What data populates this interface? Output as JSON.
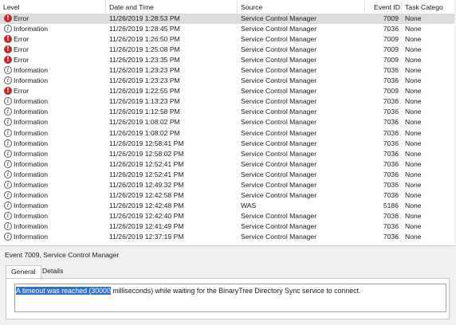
{
  "columns": {
    "level": "Level",
    "date_time": "Date and Time",
    "source": "Source",
    "event_id": "Event ID",
    "task_category": "Task Catego"
  },
  "events": [
    {
      "level": "Error",
      "type": "error",
      "date": "11/26/2019 1:28:53 PM",
      "source": "Service Control Manager",
      "event_id": "7009",
      "task": "None",
      "selected": true
    },
    {
      "level": "Information",
      "type": "info",
      "date": "11/26/2019 1:28:45 PM",
      "source": "Service Control Manager",
      "event_id": "7036",
      "task": "None"
    },
    {
      "level": "Error",
      "type": "error",
      "date": "11/26/2019 1:26:50 PM",
      "source": "Service Control Manager",
      "event_id": "7009",
      "task": "None"
    },
    {
      "level": "Error",
      "type": "error",
      "date": "11/26/2019 1:25:08 PM",
      "source": "Service Control Manager",
      "event_id": "7009",
      "task": "None"
    },
    {
      "level": "Error",
      "type": "error",
      "date": "11/26/2019 1:23:35 PM",
      "source": "Service Control Manager",
      "event_id": "7009",
      "task": "None"
    },
    {
      "level": "Information",
      "type": "info",
      "date": "11/26/2019 1:23:23 PM",
      "source": "Service Control Manager",
      "event_id": "7036",
      "task": "None"
    },
    {
      "level": "Information",
      "type": "info",
      "date": "11/26/2019 1:23:23 PM",
      "source": "Service Control Manager",
      "event_id": "7036",
      "task": "None"
    },
    {
      "level": "Error",
      "type": "error",
      "date": "11/26/2019 1:22:55 PM",
      "source": "Service Control Manager",
      "event_id": "7009",
      "task": "None"
    },
    {
      "level": "Information",
      "type": "info",
      "date": "11/26/2019 1:13:23 PM",
      "source": "Service Control Manager",
      "event_id": "7036",
      "task": "None"
    },
    {
      "level": "Information",
      "type": "info",
      "date": "11/26/2019 1:12:58 PM",
      "source": "Service Control Manager",
      "event_id": "7036",
      "task": "None"
    },
    {
      "level": "Information",
      "type": "info",
      "date": "11/26/2019 1:08:02 PM",
      "source": "Service Control Manager",
      "event_id": "7036",
      "task": "None"
    },
    {
      "level": "Information",
      "type": "info",
      "date": "11/26/2019 1:08:02 PM",
      "source": "Service Control Manager",
      "event_id": "7036",
      "task": "None"
    },
    {
      "level": "Information",
      "type": "info",
      "date": "11/26/2019 12:58:41 PM",
      "source": "Service Control Manager",
      "event_id": "7036",
      "task": "None"
    },
    {
      "level": "Information",
      "type": "info",
      "date": "11/26/2019 12:58:02 PM",
      "source": "Service Control Manager",
      "event_id": "7036",
      "task": "None"
    },
    {
      "level": "Information",
      "type": "info",
      "date": "11/26/2019 12:52:41 PM",
      "source": "Service Control Manager",
      "event_id": "7036",
      "task": "None"
    },
    {
      "level": "Information",
      "type": "info",
      "date": "11/26/2019 12:52:41 PM",
      "source": "Service Control Manager",
      "event_id": "7036",
      "task": "None"
    },
    {
      "level": "Information",
      "type": "info",
      "date": "11/26/2019 12:49:32 PM",
      "source": "Service Control Manager",
      "event_id": "7036",
      "task": "None"
    },
    {
      "level": "Information",
      "type": "info",
      "date": "11/26/2019 12:42:58 PM",
      "source": "Service Control Manager",
      "event_id": "7036",
      "task": "None"
    },
    {
      "level": "Information",
      "type": "info",
      "date": "11/26/2019 12:42:48 PM",
      "source": "WAS",
      "event_id": "5186",
      "task": "None"
    },
    {
      "level": "Information",
      "type": "info",
      "date": "11/26/2019 12:42:40 PM",
      "source": "Service Control Manager",
      "event_id": "7036",
      "task": "None"
    },
    {
      "level": "Information",
      "type": "info",
      "date": "11/26/2019 12:41:49 PM",
      "source": "Service Control Manager",
      "event_id": "7036",
      "task": "None"
    },
    {
      "level": "Information",
      "type": "info",
      "date": "11/26/2019 12:37:19 PM",
      "source": "Service Control Manager",
      "event_id": "7036",
      "task": "None"
    }
  ],
  "detail": {
    "title": "Event 7009, Service Control Manager",
    "tabs": [
      "General",
      "Details"
    ],
    "active_tab": "General",
    "message_selected": "A timeout was reached (30000",
    "message_rest": " milliseconds) while waiting for the BinaryTree Directory Sync service to connect."
  },
  "icons": {
    "error": "error-icon",
    "info": "information-icon"
  },
  "colors": {
    "error_icon": "#c4262e",
    "selected_row": "#dcdcdc",
    "text_selection": "#3070c8",
    "pane_background": "#f0f0f0"
  }
}
